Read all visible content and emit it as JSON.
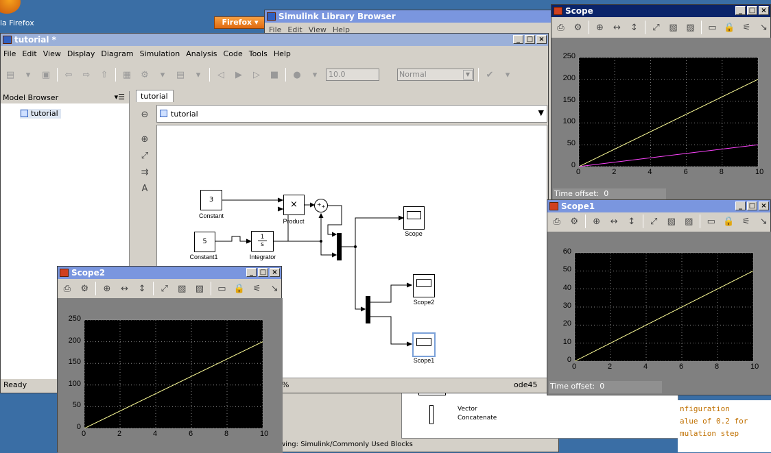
{
  "desktop": {
    "firefox_label": "la Firefox",
    "firefox_button": "Firefox"
  },
  "library": {
    "title": "Simulink Library Browser",
    "menu": [
      "File",
      "Edit",
      "View",
      "Help"
    ],
    "block_label_1": "Vector",
    "block_label_2": "Concatenate",
    "status": "wing: Simulink/Commonly Used Blocks"
  },
  "helptext": {
    "line1": "nfiguration",
    "line2": "alue of 0.2 for",
    "line3": "mulation step"
  },
  "editor": {
    "title": "tutorial *",
    "menu": [
      "File",
      "Edit",
      "View",
      "Display",
      "Diagram",
      "Simulation",
      "Analysis",
      "Code",
      "Tools",
      "Help"
    ],
    "stop_time": "10.0",
    "sim_mode": "Normal",
    "model_browser": "Model Browser",
    "tree_item": "tutorial",
    "tab": "tutorial",
    "address": "tutorial",
    "status_left": "Ready",
    "status_pct": "%",
    "status_solver": "ode45",
    "blocks": {
      "const1_val": "3",
      "const1_label": "Constant",
      "const2_val": "5",
      "const2_label": "Constant1",
      "integrator_num": "1",
      "integrator_den": "s",
      "integrator_label": "Integrator",
      "product_symbol": "×",
      "product_label": "Product",
      "scope_label": "Scope",
      "scope2_label": "Scope2",
      "scope1_label": "Scope1"
    }
  },
  "scope": {
    "title": "Scope",
    "time_offset_label": "Time offset:",
    "time_offset": "0"
  },
  "scope1": {
    "title": "Scope1",
    "time_offset_label": "Time offset:",
    "time_offset": "0"
  },
  "scope2": {
    "title": "Scope2"
  },
  "chart_data": [
    {
      "type": "line",
      "title": "Scope",
      "xlim": [
        0,
        10
      ],
      "ylim": [
        0,
        250
      ],
      "grid": true,
      "xticks": [
        0,
        2,
        4,
        6,
        8,
        10
      ],
      "yticks": [
        0,
        50,
        100,
        150,
        200,
        250
      ],
      "series": [
        {
          "color": "#ffff99",
          "x": [
            0,
            10
          ],
          "y": [
            0,
            200
          ]
        },
        {
          "color": "#ff44ff",
          "x": [
            0,
            10
          ],
          "y": [
            0,
            50
          ]
        }
      ]
    },
    {
      "type": "line",
      "title": "Scope1",
      "xlim": [
        0,
        10
      ],
      "ylim": [
        0,
        60
      ],
      "grid": true,
      "xticks": [
        0,
        2,
        4,
        6,
        8,
        10
      ],
      "yticks": [
        0,
        10,
        20,
        30,
        40,
        50,
        60
      ],
      "series": [
        {
          "color": "#ffff99",
          "x": [
            0,
            10
          ],
          "y": [
            0,
            50
          ]
        }
      ]
    },
    {
      "type": "line",
      "title": "Scope2",
      "xlim": [
        0,
        10
      ],
      "ylim": [
        0,
        250
      ],
      "grid": true,
      "xticks": [
        0,
        2,
        4,
        6,
        8,
        10
      ],
      "yticks": [
        0,
        50,
        100,
        150,
        200,
        250
      ],
      "series": [
        {
          "color": "#ffff99",
          "x": [
            0,
            10
          ],
          "y": [
            0,
            200
          ]
        }
      ]
    }
  ]
}
